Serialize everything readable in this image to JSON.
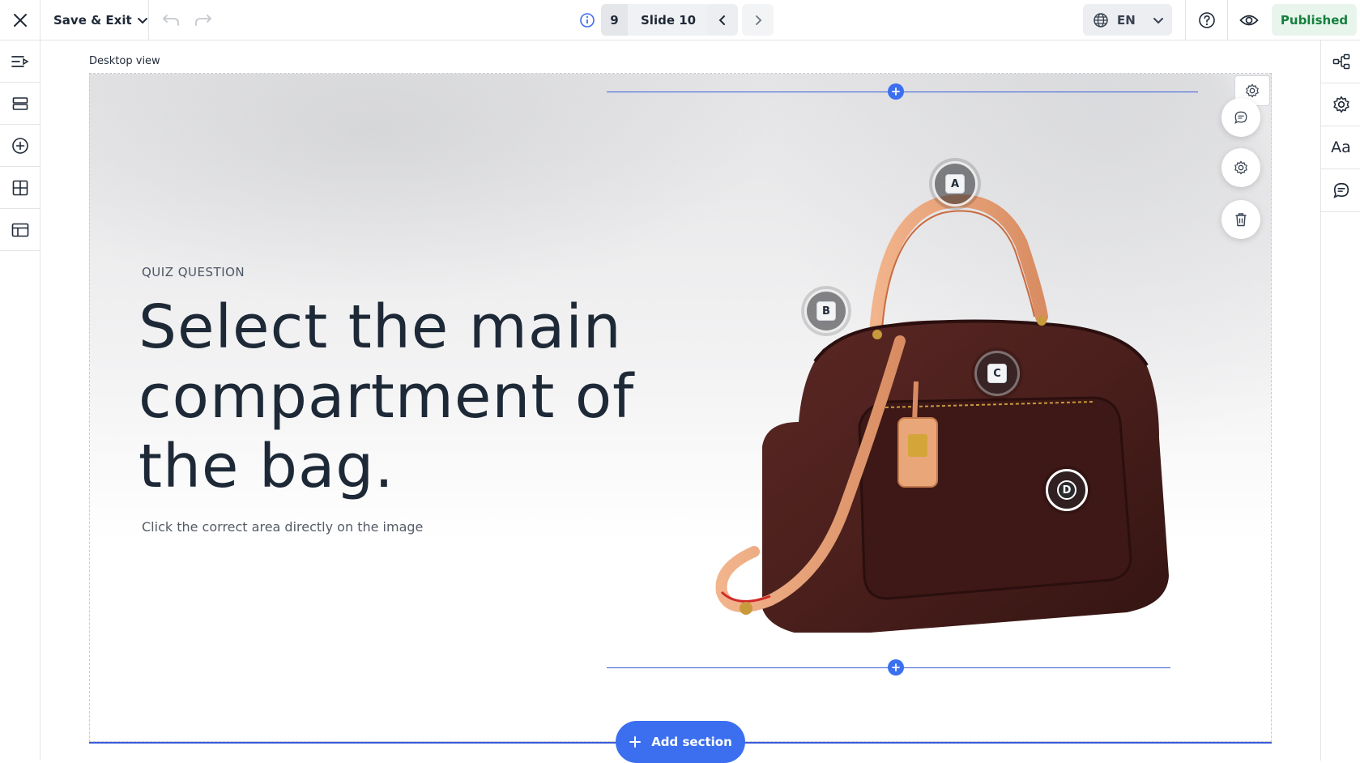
{
  "topbar": {
    "save_exit_label": "Save & Exit",
    "slide_number": "9",
    "slide_name": "Slide 10",
    "language": "EN",
    "status": "Published",
    "icons": [
      "close-icon",
      "chevron-down-icon",
      "undo-icon",
      "redo-icon",
      "info-icon",
      "chevron-left-icon",
      "chevron-right-icon",
      "globe-icon",
      "help-icon",
      "eye-icon"
    ]
  },
  "leftbar": {
    "icons": [
      "outline-icon",
      "layers-icon",
      "add-circle-icon",
      "grid-icon",
      "layout-icon"
    ]
  },
  "rightbar": {
    "icons": [
      "share-nodes-icon",
      "settings-icon",
      "typography-icon",
      "comment-icon"
    ],
    "typography_label": "Aa"
  },
  "canvas": {
    "view_label": "Desktop view",
    "kicker": "QUIZ QUESTION",
    "headline": "Select the main compartment of the bag.",
    "subtext": "Click the correct area directly on the image",
    "hotspots": [
      "A",
      "B",
      "C",
      "D"
    ],
    "add_section_label": "Add section"
  },
  "colors": {
    "accent": "#3b6ff0",
    "published": "#15803d",
    "published_bg": "#e8f5ec",
    "bag_leather": "#4a1f1c",
    "strap": "#e8a97f"
  }
}
